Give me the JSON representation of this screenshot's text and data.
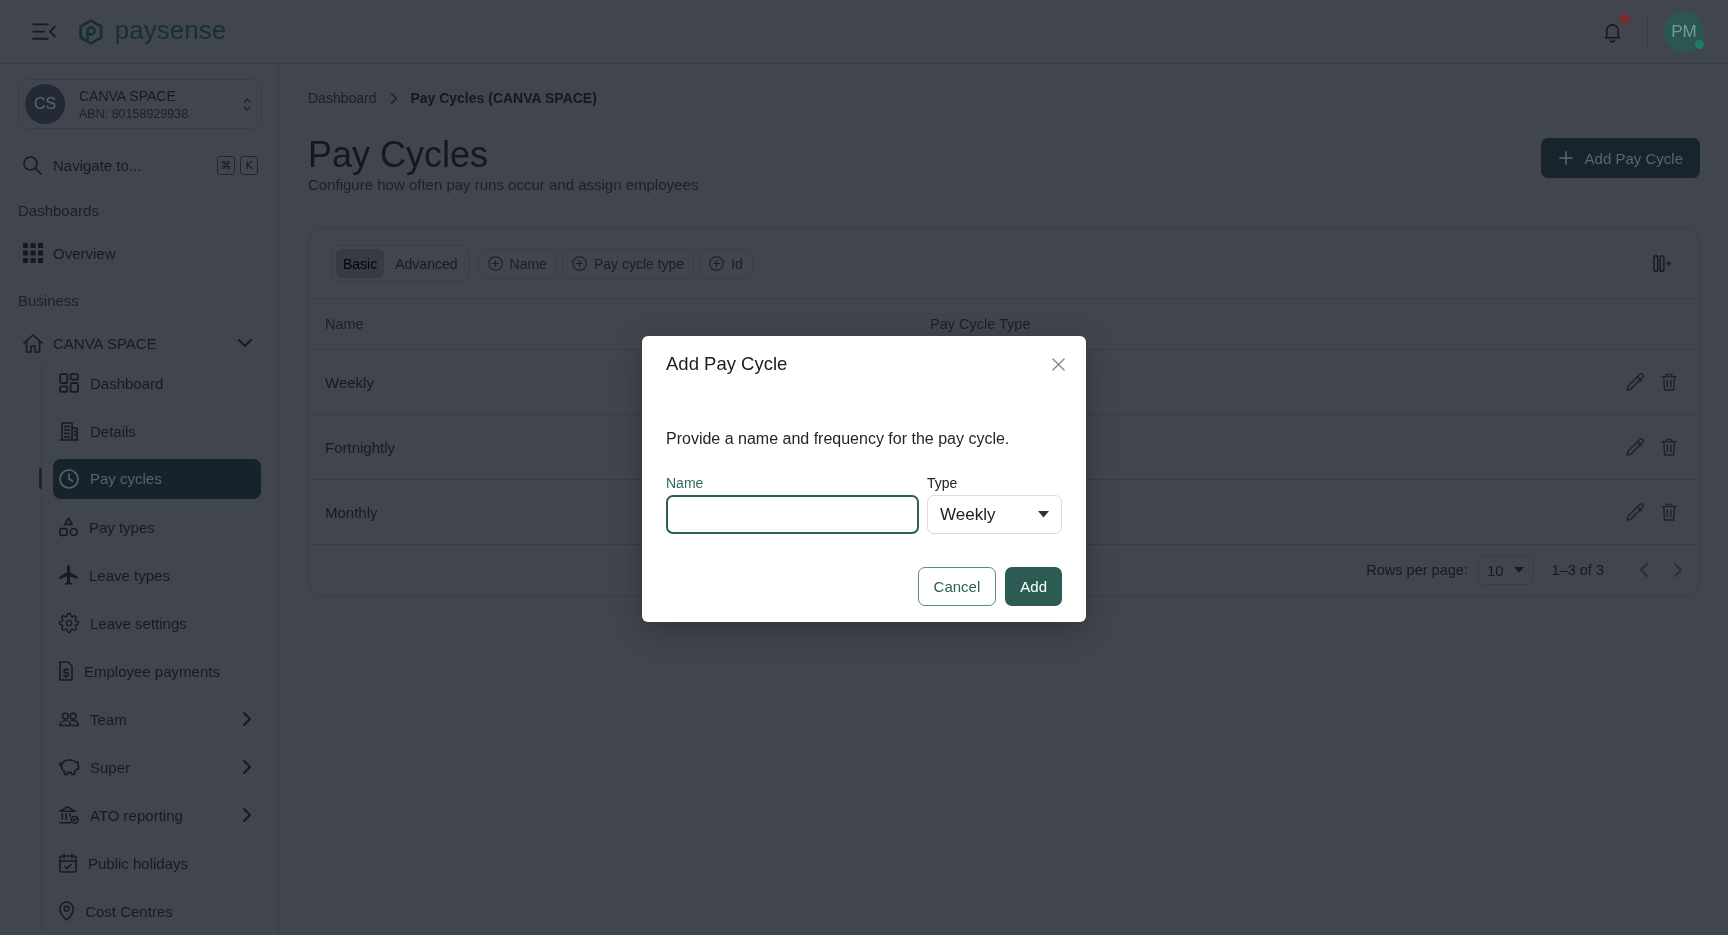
{
  "top_bar": {
    "brand": "paysense",
    "notifications": {
      "unread": true
    },
    "avatar": {
      "initials": "PM",
      "online": true
    }
  },
  "sidebar": {
    "org": {
      "initials": "CS",
      "name": "CANVA SPACE",
      "abn": "ABN: 80158929938"
    },
    "search": {
      "placeholder": "Navigate to...",
      "shortcut": [
        "⌘",
        "K"
      ]
    },
    "sections": [
      {
        "title": "Dashboards",
        "items": [
          {
            "label": "Overview",
            "selected": false
          }
        ]
      },
      {
        "title": "Business",
        "items": [
          {
            "label": "CANVA SPACE",
            "selected": false,
            "expanded": true,
            "children": [
              {
                "label": "Dashboard",
                "selected": false
              },
              {
                "label": "Details",
                "selected": false
              },
              {
                "label": "Pay cycles",
                "selected": true
              },
              {
                "label": "Pay types",
                "selected": false
              },
              {
                "label": "Leave types",
                "selected": false
              },
              {
                "label": "Leave settings",
                "selected": false
              },
              {
                "label": "Employee payments",
                "selected": false
              },
              {
                "label": "Team",
                "selected": false,
                "expanded": false
              },
              {
                "label": "Super",
                "selected": false,
                "expanded": false
              },
              {
                "label": "ATO reporting",
                "selected": false,
                "expanded": false
              },
              {
                "label": "Public holidays",
                "selected": false
              },
              {
                "label": "Cost Centres",
                "selected": false
              }
            ]
          }
        ]
      }
    ]
  },
  "breadcrumb": [
    {
      "label": "Dashboard",
      "current": false
    },
    {
      "label": "Pay Cycles (CANVA SPACE)",
      "current": true
    }
  ],
  "page": {
    "title": "Pay Cycles",
    "subtitle": "Configure how often pay runs occur and assign employees",
    "action": "Add Pay Cycle"
  },
  "table": {
    "view_modes": [
      {
        "label": "Basic",
        "selected": true
      },
      {
        "label": "Advanced",
        "selected": false
      }
    ],
    "filters": [
      "Name",
      "Pay cycle type",
      "Id"
    ],
    "columns": [
      "Name",
      "Pay Cycle Type"
    ],
    "rows": [
      {
        "cells": [
          "Weekly"
        ]
      },
      {
        "cells": [
          "Fortnightly"
        ]
      },
      {
        "cells": [
          "Monthly"
        ]
      }
    ],
    "footer": {
      "rows_per_page_label": "Rows per page:",
      "rows_per_page": "10",
      "range": "1–3 of 3",
      "prev_disabled": true,
      "next_disabled": true
    }
  },
  "dialog": {
    "title": "Add Pay Cycle",
    "description": "Provide a name and frequency for the pay cycle.",
    "fields": [
      {
        "kind": "text",
        "label": "Name",
        "focused": true
      },
      {
        "kind": "select",
        "label": "Type",
        "value": "Weekly",
        "focused": false
      }
    ],
    "buttons": [
      {
        "kind": "cancel",
        "label": "Cancel"
      },
      {
        "kind": "confirm",
        "label": "Add"
      }
    ]
  }
}
